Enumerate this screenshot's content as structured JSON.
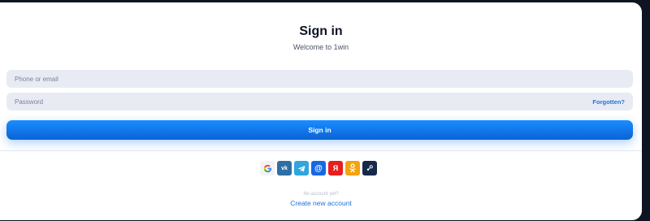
{
  "modal": {
    "title": "Sign in",
    "subtitle": "Welcome to 1win"
  },
  "form": {
    "phone_placeholder": "Phone or email",
    "password_placeholder": "Password",
    "forgot_label": "Forgotten?",
    "submit_label": "Sign in"
  },
  "social": {
    "providers": [
      "google-icon",
      "vk-icon",
      "telegram-icon",
      "mail-ru-icon",
      "yandex-icon",
      "odnoklassniki-icon",
      "steam-icon"
    ],
    "vk_text": "vk",
    "mail_text": "@",
    "yandex_text": "Я"
  },
  "footer": {
    "no_account_text": "No account yet?",
    "create_account_label": "Create new account"
  },
  "colors": {
    "accent": "#1b74d8",
    "button": "#0f7cf0",
    "field_bg": "#e9ebf4"
  }
}
